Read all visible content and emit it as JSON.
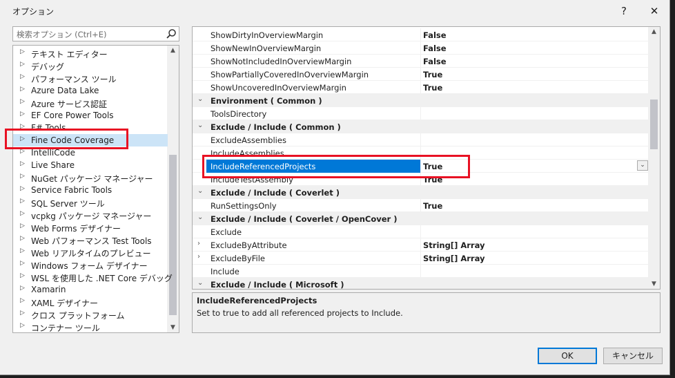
{
  "window": {
    "title": "オプション",
    "help_glyph": "?",
    "close_glyph": "✕"
  },
  "search": {
    "placeholder": "検索オプション (Ctrl+E)"
  },
  "tree": {
    "items": [
      {
        "label": "テキスト エディター"
      },
      {
        "label": "デバッグ"
      },
      {
        "label": "パフォーマンス ツール"
      },
      {
        "label": "Azure Data Lake"
      },
      {
        "label": "Azure サービス認証"
      },
      {
        "label": "EF Core Power Tools"
      },
      {
        "label": "F# Tools"
      },
      {
        "label": "Fine Code Coverage"
      },
      {
        "label": "IntelliCode"
      },
      {
        "label": "Live Share"
      },
      {
        "label": "NuGet パッケージ マネージャー"
      },
      {
        "label": "Service Fabric Tools"
      },
      {
        "label": "SQL Server ツール"
      },
      {
        "label": "vcpkg パッケージ マネージャー"
      },
      {
        "label": "Web Forms デザイナー"
      },
      {
        "label": "Web パフォーマンス Test Tools"
      },
      {
        "label": "Web リアルタイムのプレビュー"
      },
      {
        "label": "Windows フォーム デザイナー"
      },
      {
        "label": "WSL を使用した .NET Core デバッグ"
      },
      {
        "label": "Xamarin"
      },
      {
        "label": "XAML デザイナー"
      },
      {
        "label": "クロス プラットフォーム"
      },
      {
        "label": "コンテナー ツール"
      }
    ],
    "selected": "Fine Code Coverage"
  },
  "grid": {
    "rows": [
      {
        "name": "ShowDirtyInOverviewMargin",
        "value": "False"
      },
      {
        "name": "ShowNewInOverviewMargin",
        "value": "False"
      },
      {
        "name": "ShowNotIncludedInOverviewMargin",
        "value": "False"
      },
      {
        "name": "ShowPartiallyCoveredInOverviewMargin",
        "value": "True"
      },
      {
        "name": "ShowUncoveredInOverviewMargin",
        "value": "True"
      },
      {
        "name": "Environment ( Common )",
        "category": true
      },
      {
        "name": "ToolsDirectory",
        "value": ""
      },
      {
        "name": "Exclude / Include ( Common )",
        "category": true
      },
      {
        "name": "ExcludeAssemblies",
        "value": ""
      },
      {
        "name": "IncludeAssemblies",
        "value": ""
      },
      {
        "name": "IncludeReferencedProjects",
        "value": "True",
        "selected": true
      },
      {
        "name": "IncludeTestAssembly",
        "value": "True"
      },
      {
        "name": "Exclude / Include ( Coverlet )",
        "category": true
      },
      {
        "name": "RunSettingsOnly",
        "value": "True"
      },
      {
        "name": "Exclude / Include ( Coverlet / OpenCover )",
        "category": true
      },
      {
        "name": "Exclude",
        "value": ""
      },
      {
        "name": "ExcludeByAttribute",
        "value": "String[] Array",
        "expandable": true
      },
      {
        "name": "ExcludeByFile",
        "value": "String[] Array",
        "expandable": true
      },
      {
        "name": "Include",
        "value": ""
      },
      {
        "name": "Exclude / Include ( Microsoft )",
        "category": true
      }
    ]
  },
  "description": {
    "title": "IncludeReferencedProjects",
    "text": "Set to true to add all referenced projects to Include."
  },
  "buttons": {
    "ok": "OK",
    "cancel": "キャンセル"
  },
  "colors": {
    "selection": "#0078d7",
    "highlight_box": "#e81123"
  }
}
